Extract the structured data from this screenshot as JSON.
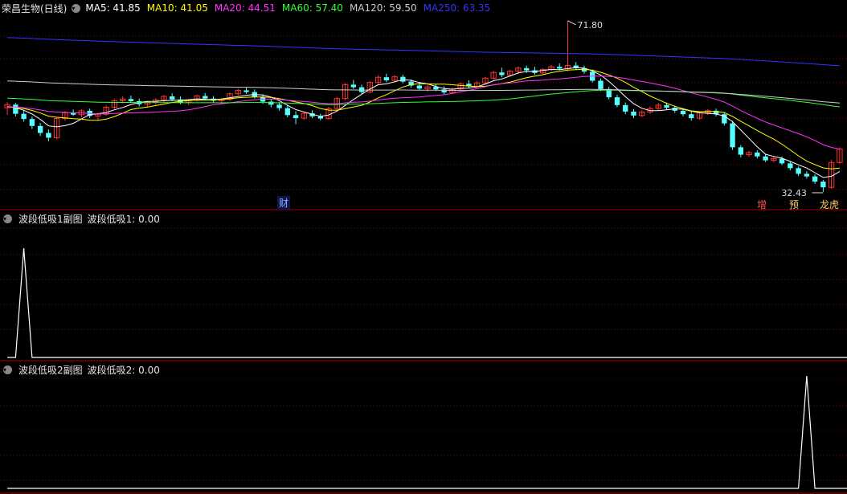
{
  "main": {
    "stock_title": "荣昌生物(日线)",
    "ma_legend": [
      {
        "label": "MA5: 41.85",
        "color": "#ffffff"
      },
      {
        "label": "MA10: 41.05",
        "color": "#ffff00"
      },
      {
        "label": "MA20: 44.51",
        "color": "#ff33ff"
      },
      {
        "label": "MA60: 57.40",
        "color": "#33ff33"
      },
      {
        "label": "MA120: 59.50",
        "color": "#cccccc"
      },
      {
        "label": "MA250: 63.35",
        "color": "#3333ff"
      }
    ],
    "high_label": "71.80",
    "low_label": "32.43",
    "events": [
      "财",
      "增",
      "预",
      "龙虎"
    ]
  },
  "sub1": {
    "title": "波段低吸1副图",
    "value_label": "波段低吸1: 0.00"
  },
  "sub2": {
    "title": "波段低吸2副图",
    "value_label": "波段低吸2: 0.00"
  },
  "colors": {
    "up": "#ff3333",
    "down": "#54ffff",
    "grid": "#7a0000",
    "axis": "#b00000"
  },
  "chart_data": [
    {
      "type": "candlestick",
      "title": "荣昌生物(日线)",
      "price_range": [
        32.43,
        71.8
      ],
      "candles": [
        [
          51.8,
          53.1,
          50.2,
          52.5
        ],
        [
          52.5,
          52.9,
          49.8,
          50.4
        ],
        [
          50.4,
          51.2,
          48.6,
          49.2
        ],
        [
          49.2,
          49.8,
          46.9,
          47.6
        ],
        [
          47.6,
          48.3,
          45.3,
          46.0
        ],
        [
          46.0,
          46.8,
          44.1,
          44.9
        ],
        [
          44.9,
          49.6,
          44.5,
          49.3
        ],
        [
          49.3,
          51.0,
          48.8,
          50.6
        ],
        [
          50.6,
          51.4,
          49.9,
          50.2
        ],
        [
          50.2,
          51.5,
          49.6,
          51.1
        ],
        [
          51.1,
          51.6,
          49.4,
          49.9
        ],
        [
          49.9,
          50.6,
          48.8,
          50.3
        ],
        [
          50.3,
          52.3,
          50.0,
          51.9
        ],
        [
          51.9,
          53.8,
          51.5,
          53.4
        ],
        [
          53.4,
          54.4,
          52.8,
          53.8
        ],
        [
          53.8,
          54.6,
          52.9,
          53.3
        ],
        [
          53.3,
          53.9,
          52.1,
          52.6
        ],
        [
          52.6,
          53.4,
          51.9,
          53.1
        ],
        [
          53.1,
          54.0,
          52.5,
          53.6
        ],
        [
          53.6,
          54.7,
          53.0,
          54.4
        ],
        [
          54.4,
          55.1,
          53.3,
          53.7
        ],
        [
          53.7,
          54.4,
          52.6,
          53.0
        ],
        [
          53.0,
          53.8,
          52.4,
          53.5
        ],
        [
          53.5,
          54.8,
          53.2,
          54.5
        ],
        [
          54.5,
          55.2,
          53.5,
          53.9
        ],
        [
          53.9,
          54.5,
          52.9,
          53.4
        ],
        [
          53.4,
          54.0,
          52.6,
          53.7
        ],
        [
          53.7,
          55.3,
          53.4,
          55.0
        ],
        [
          55.0,
          56.2,
          54.6,
          55.8
        ],
        [
          55.8,
          56.6,
          55.0,
          55.4
        ],
        [
          55.4,
          56.0,
          53.9,
          54.3
        ],
        [
          54.3,
          54.9,
          52.7,
          53.2
        ],
        [
          53.2,
          53.8,
          51.9,
          52.5
        ],
        [
          52.5,
          53.1,
          51.1,
          51.7
        ],
        [
          51.7,
          52.3,
          49.6,
          50.1
        ],
        [
          50.1,
          51.0,
          48.0,
          49.4
        ],
        [
          49.4,
          50.8,
          49.0,
          50.5
        ],
        [
          50.5,
          51.2,
          49.4,
          49.8
        ],
        [
          49.8,
          50.4,
          48.9,
          49.3
        ],
        [
          49.3,
          52.0,
          49.0,
          51.6
        ],
        [
          51.6,
          54.3,
          51.2,
          53.9
        ],
        [
          53.9,
          57.5,
          53.5,
          57.1
        ],
        [
          57.1,
          58.2,
          56.1,
          56.5
        ],
        [
          56.5,
          57.1,
          55.0,
          55.4
        ],
        [
          55.4,
          57.9,
          55.1,
          57.6
        ],
        [
          57.6,
          59.2,
          57.2,
          58.8
        ],
        [
          58.8,
          59.6,
          57.7,
          58.1
        ],
        [
          58.1,
          59.3,
          57.5,
          58.9
        ],
        [
          58.9,
          59.4,
          57.4,
          57.8
        ],
        [
          57.8,
          58.3,
          56.4,
          56.9
        ],
        [
          56.9,
          57.7,
          55.8,
          56.2
        ],
        [
          56.2,
          57.1,
          55.5,
          56.6
        ],
        [
          56.6,
          57.3,
          55.6,
          56.0
        ],
        [
          56.0,
          56.7,
          54.8,
          55.3
        ],
        [
          55.3,
          56.4,
          55.0,
          56.1
        ],
        [
          56.1,
          57.6,
          55.8,
          57.3
        ],
        [
          57.3,
          58.1,
          56.3,
          56.7
        ],
        [
          56.7,
          57.9,
          56.4,
          57.5
        ],
        [
          57.5,
          58.9,
          57.2,
          58.6
        ],
        [
          58.6,
          60.3,
          58.2,
          59.9
        ],
        [
          59.9,
          61.0,
          58.8,
          59.3
        ],
        [
          59.3,
          60.5,
          59.0,
          60.2
        ],
        [
          60.2,
          61.3,
          59.6,
          60.9
        ],
        [
          60.9,
          61.5,
          59.8,
          60.4
        ],
        [
          60.4,
          61.2,
          59.4,
          59.8
        ],
        [
          59.8,
          60.9,
          59.5,
          60.6
        ],
        [
          60.6,
          61.6,
          60.2,
          61.2
        ],
        [
          61.2,
          62.0,
          60.4,
          60.8
        ],
        [
          60.8,
          71.8,
          60.1,
          61.5
        ],
        [
          61.5,
          62.3,
          60.5,
          60.9
        ],
        [
          60.9,
          61.5,
          59.6,
          60.1
        ],
        [
          60.1,
          60.6,
          57.6,
          58.0
        ],
        [
          58.0,
          58.5,
          55.6,
          56.1
        ],
        [
          56.1,
          56.6,
          53.7,
          54.2
        ],
        [
          54.2,
          54.8,
          51.9,
          52.4
        ],
        [
          52.4,
          53.0,
          50.3,
          50.9
        ],
        [
          50.9,
          51.5,
          49.4,
          50.0
        ],
        [
          50.0,
          51.2,
          49.6,
          50.8
        ],
        [
          50.8,
          52.1,
          50.4,
          51.6
        ],
        [
          51.6,
          52.9,
          51.2,
          52.4
        ],
        [
          52.4,
          53.0,
          51.3,
          51.8
        ],
        [
          51.8,
          52.3,
          50.6,
          51.1
        ],
        [
          51.1,
          51.7,
          49.8,
          50.3
        ],
        [
          50.3,
          50.9,
          48.8,
          49.4
        ],
        [
          49.4,
          51.0,
          49.0,
          50.6
        ],
        [
          50.6,
          51.5,
          50.1,
          51.1
        ],
        [
          51.1,
          51.6,
          49.8,
          50.3
        ],
        [
          50.3,
          50.8,
          47.7,
          48.2
        ],
        [
          48.2,
          48.8,
          42.1,
          42.7
        ],
        [
          42.7,
          43.2,
          40.4,
          41.0
        ],
        [
          41.0,
          41.9,
          40.5,
          41.5
        ],
        [
          41.5,
          42.0,
          40.1,
          40.6
        ],
        [
          40.6,
          41.1,
          39.3,
          39.7
        ],
        [
          39.7,
          40.5,
          39.2,
          40.1
        ],
        [
          40.1,
          40.6,
          38.6,
          39.0
        ],
        [
          39.0,
          39.5,
          37.4,
          37.9
        ],
        [
          37.9,
          38.3,
          36.1,
          36.6
        ],
        [
          36.6,
          37.2,
          35.5,
          36.0
        ],
        [
          36.0,
          36.5,
          34.3,
          34.8
        ],
        [
          34.8,
          35.2,
          32.43,
          33.5
        ],
        [
          33.5,
          39.8,
          33.1,
          39.2
        ],
        [
          39.2,
          42.7,
          38.9,
          42.3
        ]
      ],
      "ma_series": [
        "MA5",
        "MA10",
        "MA20",
        "MA60",
        "MA120",
        "MA250"
      ]
    },
    {
      "type": "line",
      "title": "波段低吸1副图",
      "series": [
        {
          "name": "波段低吸1",
          "values": [
            0,
            0,
            1,
            0,
            0
          ]
        }
      ],
      "x_index": [
        0,
        1,
        2,
        3,
        102
      ]
    },
    {
      "type": "line",
      "title": "波段低吸2副图",
      "series": [
        {
          "name": "波段低吸2",
          "values": [
            0,
            0,
            1,
            0,
            0
          ]
        }
      ],
      "x_index": [
        0,
        96,
        97,
        98,
        102
      ]
    }
  ]
}
